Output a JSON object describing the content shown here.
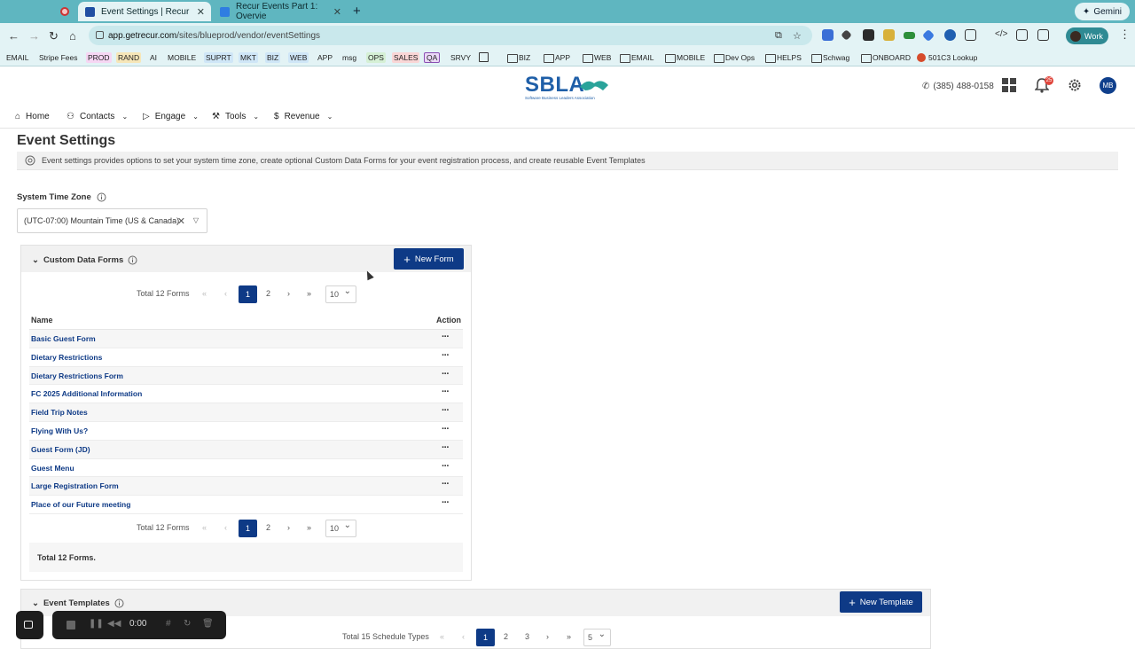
{
  "browser": {
    "tabs": [
      {
        "title": "Event Settings | Recur",
        "active": true,
        "favicon_color": "#1f4fa3"
      },
      {
        "title": "Recur Events Part 1: Overvie",
        "active": false,
        "favicon_color": "#2f7de1"
      }
    ],
    "gemini_label": "Gemini",
    "url_host": "app.getrecur.com",
    "url_path": "/sites/blueprod/vendor/eventSettings",
    "profile_label": "Work",
    "bookmarks": [
      {
        "label": "EMAIL",
        "color": ""
      },
      {
        "label": "Stripe Fees",
        "color": ""
      },
      {
        "label": "PROD",
        "color": "#f6d6f3"
      },
      {
        "label": "RAND",
        "color": "#f6e6b8"
      },
      {
        "label": "AI",
        "color": ""
      },
      {
        "label": "MOBILE",
        "color": ""
      },
      {
        "label": "SUPRT",
        "color": "#cfe6f7"
      },
      {
        "label": "MKT",
        "color": "#cfe6f7"
      },
      {
        "label": "BIZ",
        "color": "#cfe6f7"
      },
      {
        "label": "WEB",
        "color": "#cfe6f7"
      },
      {
        "label": "APP",
        "color": ""
      },
      {
        "label": "msg",
        "color": ""
      },
      {
        "label": "OPS",
        "color": "#d5f0d5"
      },
      {
        "label": "SALES",
        "color": "#f9d6d6"
      },
      {
        "label": "QA",
        "color": "#ead8f6"
      },
      {
        "label": "SRVY",
        "color": ""
      }
    ],
    "bookmark_folders": [
      "BIZ",
      "APP",
      "WEB",
      "EMAIL",
      "MOBILE",
      "Dev Ops",
      "HELPS",
      "Schwag",
      "ONBOARD"
    ],
    "bookmark_last": "501C3 Lookup"
  },
  "header": {
    "logo_text": "SBLA",
    "logo_subtext": "Software Business Leaders Association",
    "phone": "(385) 488-0158",
    "notification_count": "25",
    "avatar_initials": "MB"
  },
  "nav": {
    "items": [
      {
        "label": "Home",
        "has_caret": false
      },
      {
        "label": "Contacts",
        "has_caret": true
      },
      {
        "label": "Engage",
        "has_caret": true
      },
      {
        "label": "Tools",
        "has_caret": true
      },
      {
        "label": "Revenue",
        "has_caret": true
      }
    ]
  },
  "page": {
    "title": "Event Settings",
    "info": "Event settings provides options to set your system time zone, create optional Custom Data Forms for your event registration process, and create reusable Event Templates",
    "timezone_label": "System Time Zone",
    "timezone_value": "(UTC-07:00) Mountain Time (US & Canada)"
  },
  "custom_forms": {
    "title": "Custom Data Forms",
    "new_button": "New Form",
    "pager": {
      "total_text": "Total 12 Forms",
      "current_page": "1",
      "other_page": "2",
      "page_size": "10"
    },
    "columns": {
      "name": "Name",
      "action": "Action"
    },
    "rows": [
      "Basic Guest Form",
      "Dietary Restrictions",
      "Dietary Restrictions Form",
      "FC 2025 Additional Information",
      "Field Trip Notes",
      "Flying With Us?",
      "Guest Form (JD)",
      "Guest Menu",
      "Large Registration Form",
      "Place of our Future meeting"
    ],
    "row_action": "···",
    "footer_total": "Total 12 Forms."
  },
  "event_templates": {
    "title": "Event Templates",
    "new_button": "New Template",
    "pager": {
      "total_text": "Total 15 Schedule Types",
      "current_page": "1",
      "page2": "2",
      "page3": "3",
      "page_size": "5"
    }
  },
  "recorder": {
    "timer": "0:00"
  },
  "colors": {
    "primary": "#0e3a86",
    "chrome": "#5fb6c0",
    "link": "#0e3a86"
  }
}
